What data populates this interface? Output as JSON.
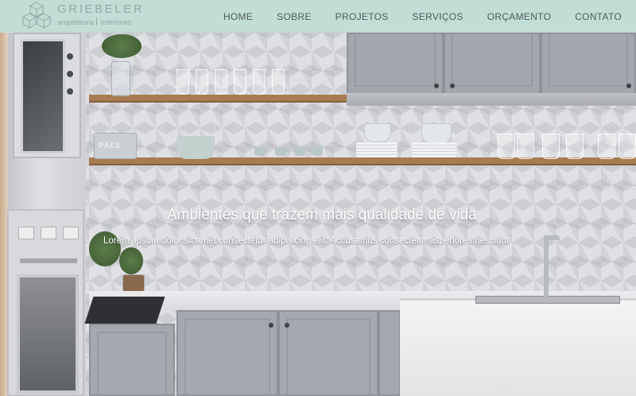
{
  "brand": {
    "name": "GRIEBELER",
    "tagline_left": "arquitetura",
    "tagline_right": "interiores",
    "color": "#8fa9a4"
  },
  "header": {
    "background": "#c2dcd6"
  },
  "nav": {
    "items": [
      {
        "label": "HOME"
      },
      {
        "label": "SOBRE"
      },
      {
        "label": "PROJETOS"
      },
      {
        "label": "SERVIÇOS"
      },
      {
        "label": "ORÇAMENTO"
      },
      {
        "label": "CONTATO"
      }
    ]
  },
  "hero": {
    "title": "Ambientes que trazem mais qualidade de vida",
    "subtitle": "Lorem, ipsum dolor sit amet consectetur adipisicing elit. Accusamus consectetur asperiores nesciunt",
    "image": "kitchen-photo",
    "jar_label": "PÃES"
  }
}
